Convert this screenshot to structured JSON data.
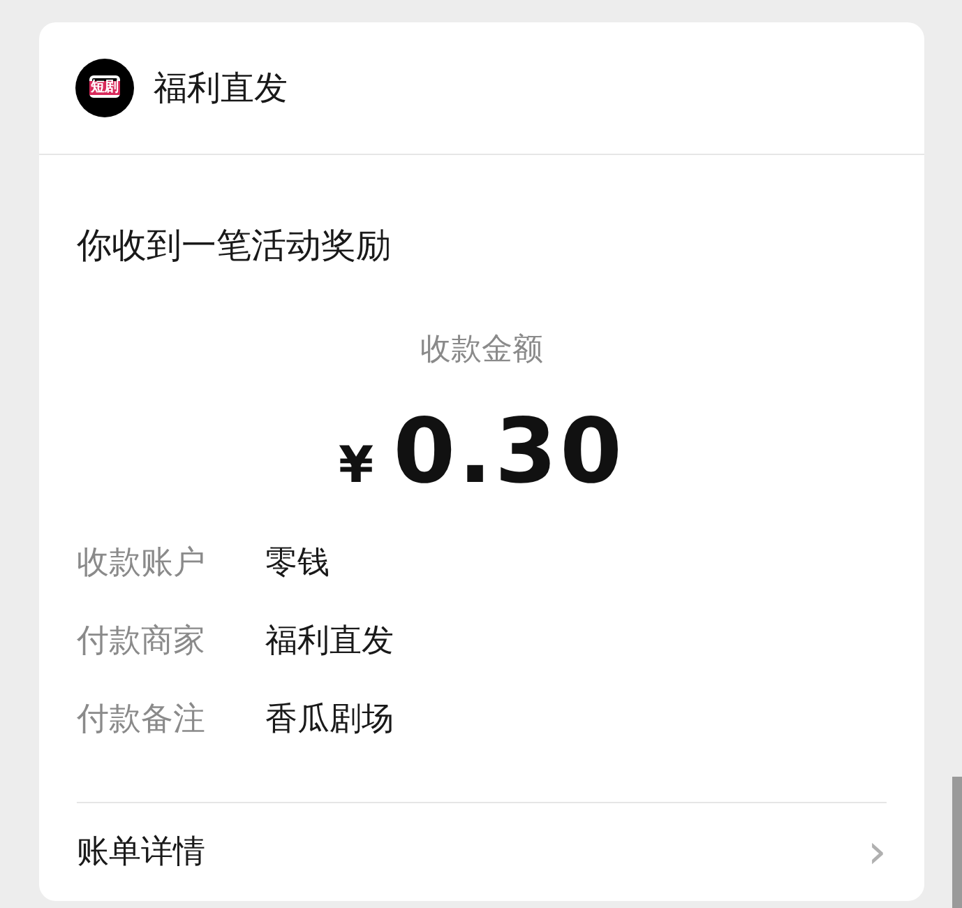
{
  "header": {
    "logo_text": "短剧",
    "title": "福利直发"
  },
  "message": "你收到一笔活动奖励",
  "amount": {
    "label": "收款金额",
    "currency": "¥",
    "value": "0.30"
  },
  "details": [
    {
      "label": "收款账户",
      "value": "零钱"
    },
    {
      "label": "付款商家",
      "value": "福利直发"
    },
    {
      "label": "付款备注",
      "value": "香瓜剧场"
    }
  ],
  "footer": {
    "label": "账单详情",
    "chevron": "›"
  }
}
